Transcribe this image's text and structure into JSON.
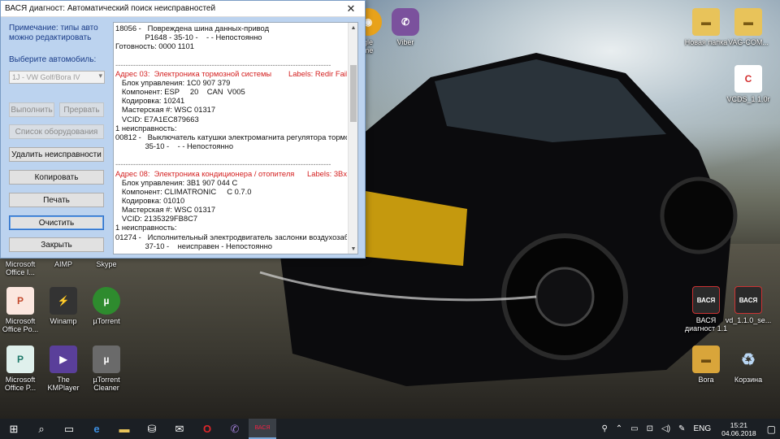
{
  "window": {
    "title": "ВАСЯ диагност: Автоматический поиск неисправностей",
    "close_glyph": "✕",
    "note": "Примечание: типы авто можно редактировать",
    "choose_label": "Выберите автомобиль:",
    "car_select": "1J - VW Golf/Bora IV",
    "buttons": {
      "run": "Выполнить",
      "stop": "Прервать",
      "equipment": "Список оборудования",
      "delete_faults": "Удалить неисправности",
      "copy": "Копировать",
      "print": "Печать",
      "clear": "Очистить",
      "close": "Закрыть"
    },
    "log": [
      {
        "t": "18056 -   Повреждена шина данных-привод",
        "c": ""
      },
      {
        "t": "              P1648 - 35-10 -    - - Непостоянно",
        "c": ""
      },
      {
        "t": "Готовность: 0000 1101",
        "c": ""
      },
      {
        "t": "",
        "c": ""
      },
      {
        "t": "-------------------------------------------------------------------------------------",
        "c": "sep"
      },
      {
        "t": "Адрес 03:  Электроника тормозной системы        Labels: Redir Fail!",
        "c": "red"
      },
      {
        "t": "   Блок управления: 1C0 907 379",
        "c": ""
      },
      {
        "t": "   Компонент: ESP     20    CAN  V005",
        "c": ""
      },
      {
        "t": "   Кодировка: 10241",
        "c": ""
      },
      {
        "t": "   Мастерская #: WSC 01317",
        "c": ""
      },
      {
        "t": "   VCID: E7A1EC879663",
        "c": ""
      },
      {
        "t": "1 неисправность:",
        "c": ""
      },
      {
        "t": "00812 -   Выключатель катушки электромагнита регулятора тормоз",
        "c": ""
      },
      {
        "t": "              35-10 -    - - Непостоянно",
        "c": ""
      },
      {
        "t": "",
        "c": ""
      },
      {
        "t": "-------------------------------------------------------------------------------------",
        "c": "sep"
      },
      {
        "t": "Адрес 08:  Электроника кондиционера / отопителя      Labels: 3Bx-9",
        "c": "red"
      },
      {
        "t": "   Блок управления: 3B1 907 044 C",
        "c": ""
      },
      {
        "t": "   Компонент: CLIMATRONIC     C 0.7.0",
        "c": ""
      },
      {
        "t": "   Кодировка: 01010",
        "c": ""
      },
      {
        "t": "   Мастерская #: WSC 01317",
        "c": ""
      },
      {
        "t": "   VCID: 2135329FB8C7",
        "c": ""
      },
      {
        "t": "1 неисправность:",
        "c": ""
      },
      {
        "t": "01274 -   Исполнительный электродвигатель заслонки воздухозабо",
        "c": ""
      },
      {
        "t": "              37-10 -    неисправен - Непостоянно",
        "c": ""
      }
    ]
  },
  "desktop": {
    "icons": [
      {
        "label": "Новая папка",
        "glyph": "▬",
        "color": "#e8c35a"
      },
      {
        "label": "VAG-COM...",
        "glyph": "▬",
        "color": "#e8c35a"
      },
      {
        "label": "VCDS_1.1.0r",
        "glyph": "C",
        "color": "#d32f2f"
      },
      {
        "label": "Viber",
        "glyph": "✆",
        "color": "#7b519d"
      },
      {
        "label": "gle\nme",
        "glyph": "◉",
        "color": "#e8a21b"
      },
      {
        "label": "Microsoft\nOffice I...",
        "glyph": "",
        "color": "#4a4a4a"
      },
      {
        "label": "AIMP",
        "glyph": "",
        "color": "#4a4a4a"
      },
      {
        "label": "Skype",
        "glyph": "",
        "color": "#4a4a4a"
      },
      {
        "label": "Microsoft\nOffice Po...",
        "glyph": "P",
        "color": "#c24a2e"
      },
      {
        "label": "Winamp",
        "glyph": "⚡",
        "color": "#333333"
      },
      {
        "label": "µTorrent",
        "glyph": "µ",
        "color": "#2e8b2e"
      },
      {
        "label": "Microsoft\nOffice P...",
        "glyph": "P",
        "color": "#1f7a6a"
      },
      {
        "label": "The\nKMPlayer",
        "glyph": "▶",
        "color": "#5a3f9a"
      },
      {
        "label": "µTorrent\nCleaner",
        "glyph": "µ",
        "color": "#6a6a6a"
      },
      {
        "label": "ВАСЯ\nдиагност 1.1",
        "glyph": "ВАСЯ",
        "color": "#2a2a2a"
      },
      {
        "label": "vd_1.1.0_se...",
        "glyph": "ВАСЯ",
        "color": "#2a2a2a"
      },
      {
        "label": "Bora",
        "glyph": "▬",
        "color": "#d9a53a"
      },
      {
        "label": "Корзина",
        "glyph": "♻",
        "color": "#5a7fa8"
      }
    ]
  },
  "taskbar": {
    "start_glyph": "⊞",
    "items": [
      "⌕",
      "▭",
      "e",
      "▬",
      "⛁",
      "✉",
      "O",
      "✆",
      "ВАСЯ"
    ],
    "tray": [
      "⚲",
      "⌃",
      "▭",
      "⊡",
      "◁)",
      "✎"
    ],
    "lang": "ENG",
    "time": "15:21",
    "date": "04.06.2018",
    "notif_glyph": "▢"
  }
}
